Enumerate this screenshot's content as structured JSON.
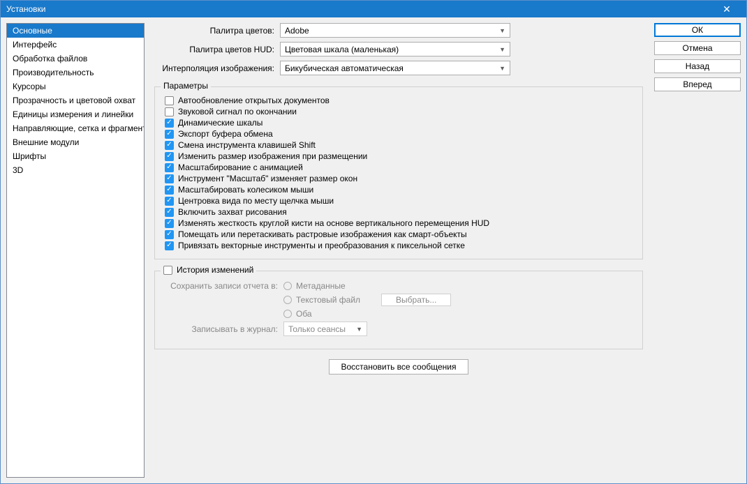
{
  "window": {
    "title": "Установки"
  },
  "sidebar": {
    "items": [
      {
        "label": "Основные",
        "selected": true
      },
      {
        "label": "Интерфейс"
      },
      {
        "label": "Обработка файлов"
      },
      {
        "label": "Производительность"
      },
      {
        "label": "Курсоры"
      },
      {
        "label": "Прозрачность и цветовой охват"
      },
      {
        "label": "Единицы измерения и линейки"
      },
      {
        "label": "Направляющие, сетка и фрагменты"
      },
      {
        "label": "Внешние модули"
      },
      {
        "label": "Шрифты"
      },
      {
        "label": "3D"
      }
    ]
  },
  "buttons": {
    "ok": "ОК",
    "cancel": "Отмена",
    "prev": "Назад",
    "next": "Вперед"
  },
  "form": {
    "colorPickerLabel": "Палитра цветов:",
    "colorPickerValue": "Adobe",
    "hudLabel": "Палитра цветов HUD:",
    "hudValue": "Цветовая шкала (маленькая)",
    "interpLabel": "Интерполяция изображения:",
    "interpValue": "Бикубическая автоматическая"
  },
  "params": {
    "legend": "Параметры",
    "items": [
      {
        "label": "Автообновление открытых документов",
        "checked": false
      },
      {
        "label": "Звуковой сигнал по окончании",
        "checked": false
      },
      {
        "label": "Динамические шкалы",
        "checked": true
      },
      {
        "label": "Экспорт буфера обмена",
        "checked": true
      },
      {
        "label": "Смена инструмента клавишей Shift",
        "checked": true
      },
      {
        "label": "Изменить размер изображения при размещении",
        "checked": true
      },
      {
        "label": "Масштабирование с анимацией",
        "checked": true
      },
      {
        "label": "Инструмент \"Масштаб\" изменяет размер окон",
        "checked": true
      },
      {
        "label": "Масштабировать колесиком мыши",
        "checked": true
      },
      {
        "label": "Центровка вида по месту щелчка мыши",
        "checked": true
      },
      {
        "label": "Включить захват рисования",
        "checked": true
      },
      {
        "label": "Изменять жесткость круглой кисти на основе вертикального перемещения HUD",
        "checked": true
      },
      {
        "label": "Помещать или перетаскивать растровые изображения как смарт-объекты",
        "checked": true
      },
      {
        "label": "Привязать векторные инструменты и преобразования к пиксельной сетке",
        "checked": true
      }
    ]
  },
  "history": {
    "legend": "История изменений",
    "saveLabel": "Сохранить записи отчета в:",
    "meta": "Метаданные",
    "text": "Текстовый файл",
    "choose": "Выбрать...",
    "both": "Оба",
    "logLabel": "Записывать в журнал:",
    "logValue": "Только сеансы"
  },
  "reset": "Восстановить все сообщения"
}
